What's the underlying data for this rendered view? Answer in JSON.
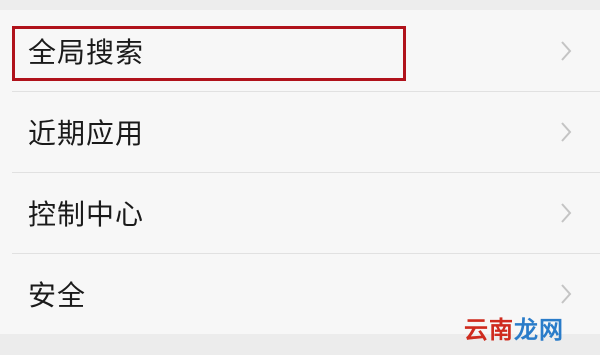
{
  "settings": {
    "items": [
      {
        "label": "全局搜索"
      },
      {
        "label": "近期应用"
      },
      {
        "label": "控制中心"
      },
      {
        "label": "安全"
      }
    ]
  },
  "watermark": {
    "part1": "云",
    "part2": "南",
    "part3": "龙网"
  },
  "colors": {
    "highlight": "#b0121b",
    "watermark_red": "#cf2b1e",
    "watermark_blue": "#2a7cc9"
  },
  "icons": {
    "row_arrow": "chevron-right-icon"
  }
}
